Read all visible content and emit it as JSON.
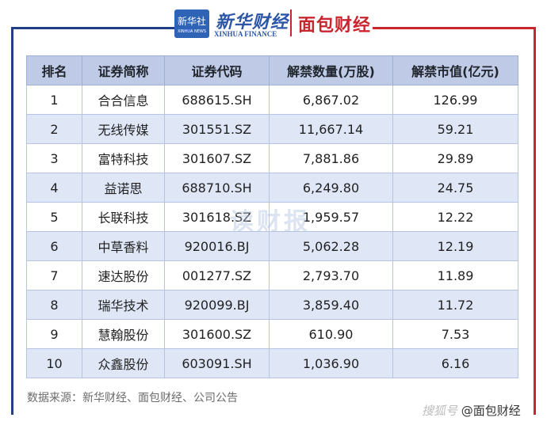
{
  "header": {
    "logo_box_label": "新华社",
    "logo_box_sub": "XINHUA NEWS",
    "xinhua_title": "新华财经",
    "xinhua_sub": "XINHUA FINANCE",
    "partner_logo": "面包财经"
  },
  "table": {
    "columns": [
      "排名",
      "证券简称",
      "证券代码",
      "解禁数量(万股)",
      "解禁市值(亿元)"
    ],
    "rows": [
      {
        "rank": "1",
        "name": "合合信息",
        "code": "688615.SH",
        "qty": "6,867.02",
        "value": "126.99"
      },
      {
        "rank": "2",
        "name": "无线传媒",
        "code": "301551.SZ",
        "qty": "11,667.14",
        "value": "59.21"
      },
      {
        "rank": "3",
        "name": "富特科技",
        "code": "301607.SZ",
        "qty": "7,881.86",
        "value": "29.89"
      },
      {
        "rank": "4",
        "name": "益诺思",
        "code": "688710.SH",
        "qty": "6,249.80",
        "value": "24.75"
      },
      {
        "rank": "5",
        "name": "长联科技",
        "code": "301618.SZ",
        "qty": "1,959.57",
        "value": "12.22"
      },
      {
        "rank": "6",
        "name": "中草香料",
        "code": "920016.BJ",
        "qty": "5,062.28",
        "value": "12.19"
      },
      {
        "rank": "7",
        "name": "速达股份",
        "code": "001277.SZ",
        "qty": "2,793.70",
        "value": "11.89"
      },
      {
        "rank": "8",
        "name": "瑞华技术",
        "code": "920099.BJ",
        "qty": "3,859.40",
        "value": "11.72"
      },
      {
        "rank": "9",
        "name": "慧翰股份",
        "code": "301600.SZ",
        "qty": "610.90",
        "value": "7.53"
      },
      {
        "rank": "10",
        "name": "众鑫股份",
        "code": "603091.SH",
        "qty": "1,036.90",
        "value": "6.16"
      }
    ]
  },
  "watermark": "读财报",
  "source": "数据来源：新华财经、面包财经、公司公告",
  "corner": {
    "ghost": "搜狐号",
    "handle": "@面包财经"
  }
}
